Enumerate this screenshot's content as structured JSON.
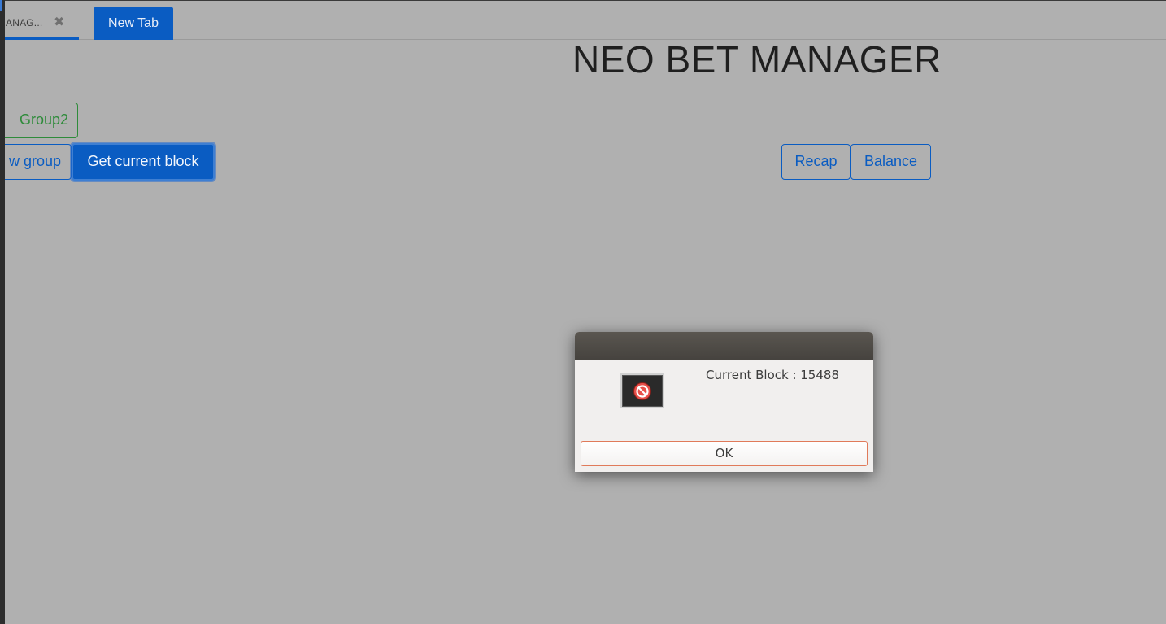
{
  "tabs": {
    "current_title": "ANAG...",
    "close_glyph": "✖",
    "new_tab_label": "New Tab"
  },
  "page": {
    "title": "NEO BET MANAGER"
  },
  "buttons": {
    "group2": "Group2",
    "new_group": "w group",
    "get_current_block": "Get current block",
    "recap": "Recap",
    "balance": "Balance"
  },
  "dialog": {
    "icon": "stop-icon",
    "message": "Current Block : 15488",
    "ok_label": "OK"
  },
  "colors": {
    "primary": "#0a5cc2",
    "success": "#2e8b3a",
    "background": "#b0b0b0"
  }
}
